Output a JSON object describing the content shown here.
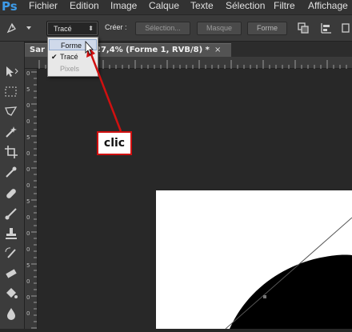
{
  "app": {
    "logo": "Ps"
  },
  "menu": [
    "Fichier",
    "Edition",
    "Image",
    "Calque",
    "Texte",
    "Sélection",
    "Filtre",
    "Affichage"
  ],
  "options_bar": {
    "mode_value": "Tracé",
    "create_label": "Créer :",
    "selection_button": "Sélection...",
    "mask_button": "Masque",
    "shape_button": "Forme"
  },
  "mode_dropdown": {
    "items": [
      {
        "label": "Forme",
        "state": "hover"
      },
      {
        "label": "Tracé",
        "state": "checked"
      },
      {
        "label": "Pixels",
        "state": "disabled"
      }
    ]
  },
  "document_tab": {
    "prefix": "Sar",
    "title_rest": "27,4% (Forme 1, RVB/8) *",
    "close": "×"
  },
  "ruler_left_labels": [
    "0",
    "5",
    "0",
    "0",
    "5",
    "0",
    "0",
    "0",
    "5",
    "0",
    "0",
    "0",
    "5",
    "0",
    "0",
    "0"
  ],
  "annotation": {
    "text": "clic",
    "color": "#d01010"
  },
  "colors": {
    "ps_blue": "#3d9be9",
    "canvas_bg": "#282828",
    "document": "#ffffff",
    "shape": "#000000",
    "annotation_red": "#d01010"
  }
}
